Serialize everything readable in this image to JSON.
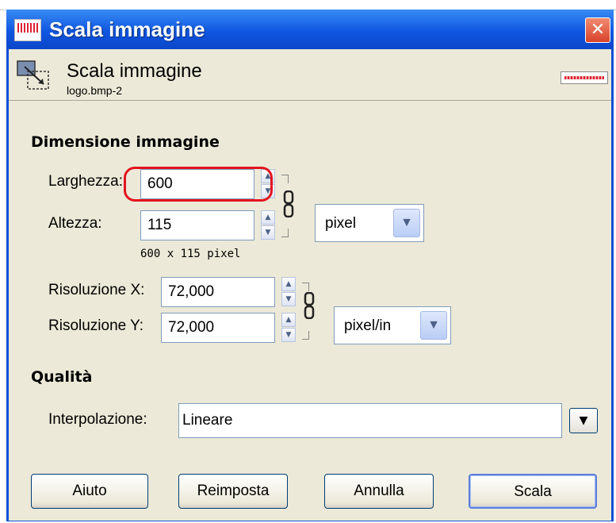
{
  "window": {
    "title": "Scala immagine",
    "close_glyph": "✕"
  },
  "header": {
    "title": "Scala immagine",
    "subtitle": "logo.bmp-2"
  },
  "image_size": {
    "section_label": "Dimensione immagine",
    "width_label": "Larghezza:",
    "width_value": "600",
    "height_label": "Altezza:",
    "height_value": "115",
    "size_info": "600 x 115 pixel",
    "unit": "pixel"
  },
  "resolution": {
    "x_label": "Risoluzione X:",
    "x_value": "72,000",
    "y_label": "Risoluzione Y:",
    "y_value": "72,000",
    "unit": "pixel/in"
  },
  "quality": {
    "section_label": "Qualità",
    "interp_label": "Interpolazione:",
    "interp_value": "Lineare"
  },
  "buttons": {
    "help": "Aiuto",
    "reset": "Reimposta",
    "cancel": "Annulla",
    "scale": "Scala"
  },
  "icons": {
    "chain": "chain-link-icon",
    "spin": "spin-arrows-icon",
    "dropdown": "chevron-down-icon"
  },
  "colors": {
    "titlebar": "#0b47c9",
    "highlight": "#e4141e",
    "dialog_bg": "#ece9d8"
  }
}
